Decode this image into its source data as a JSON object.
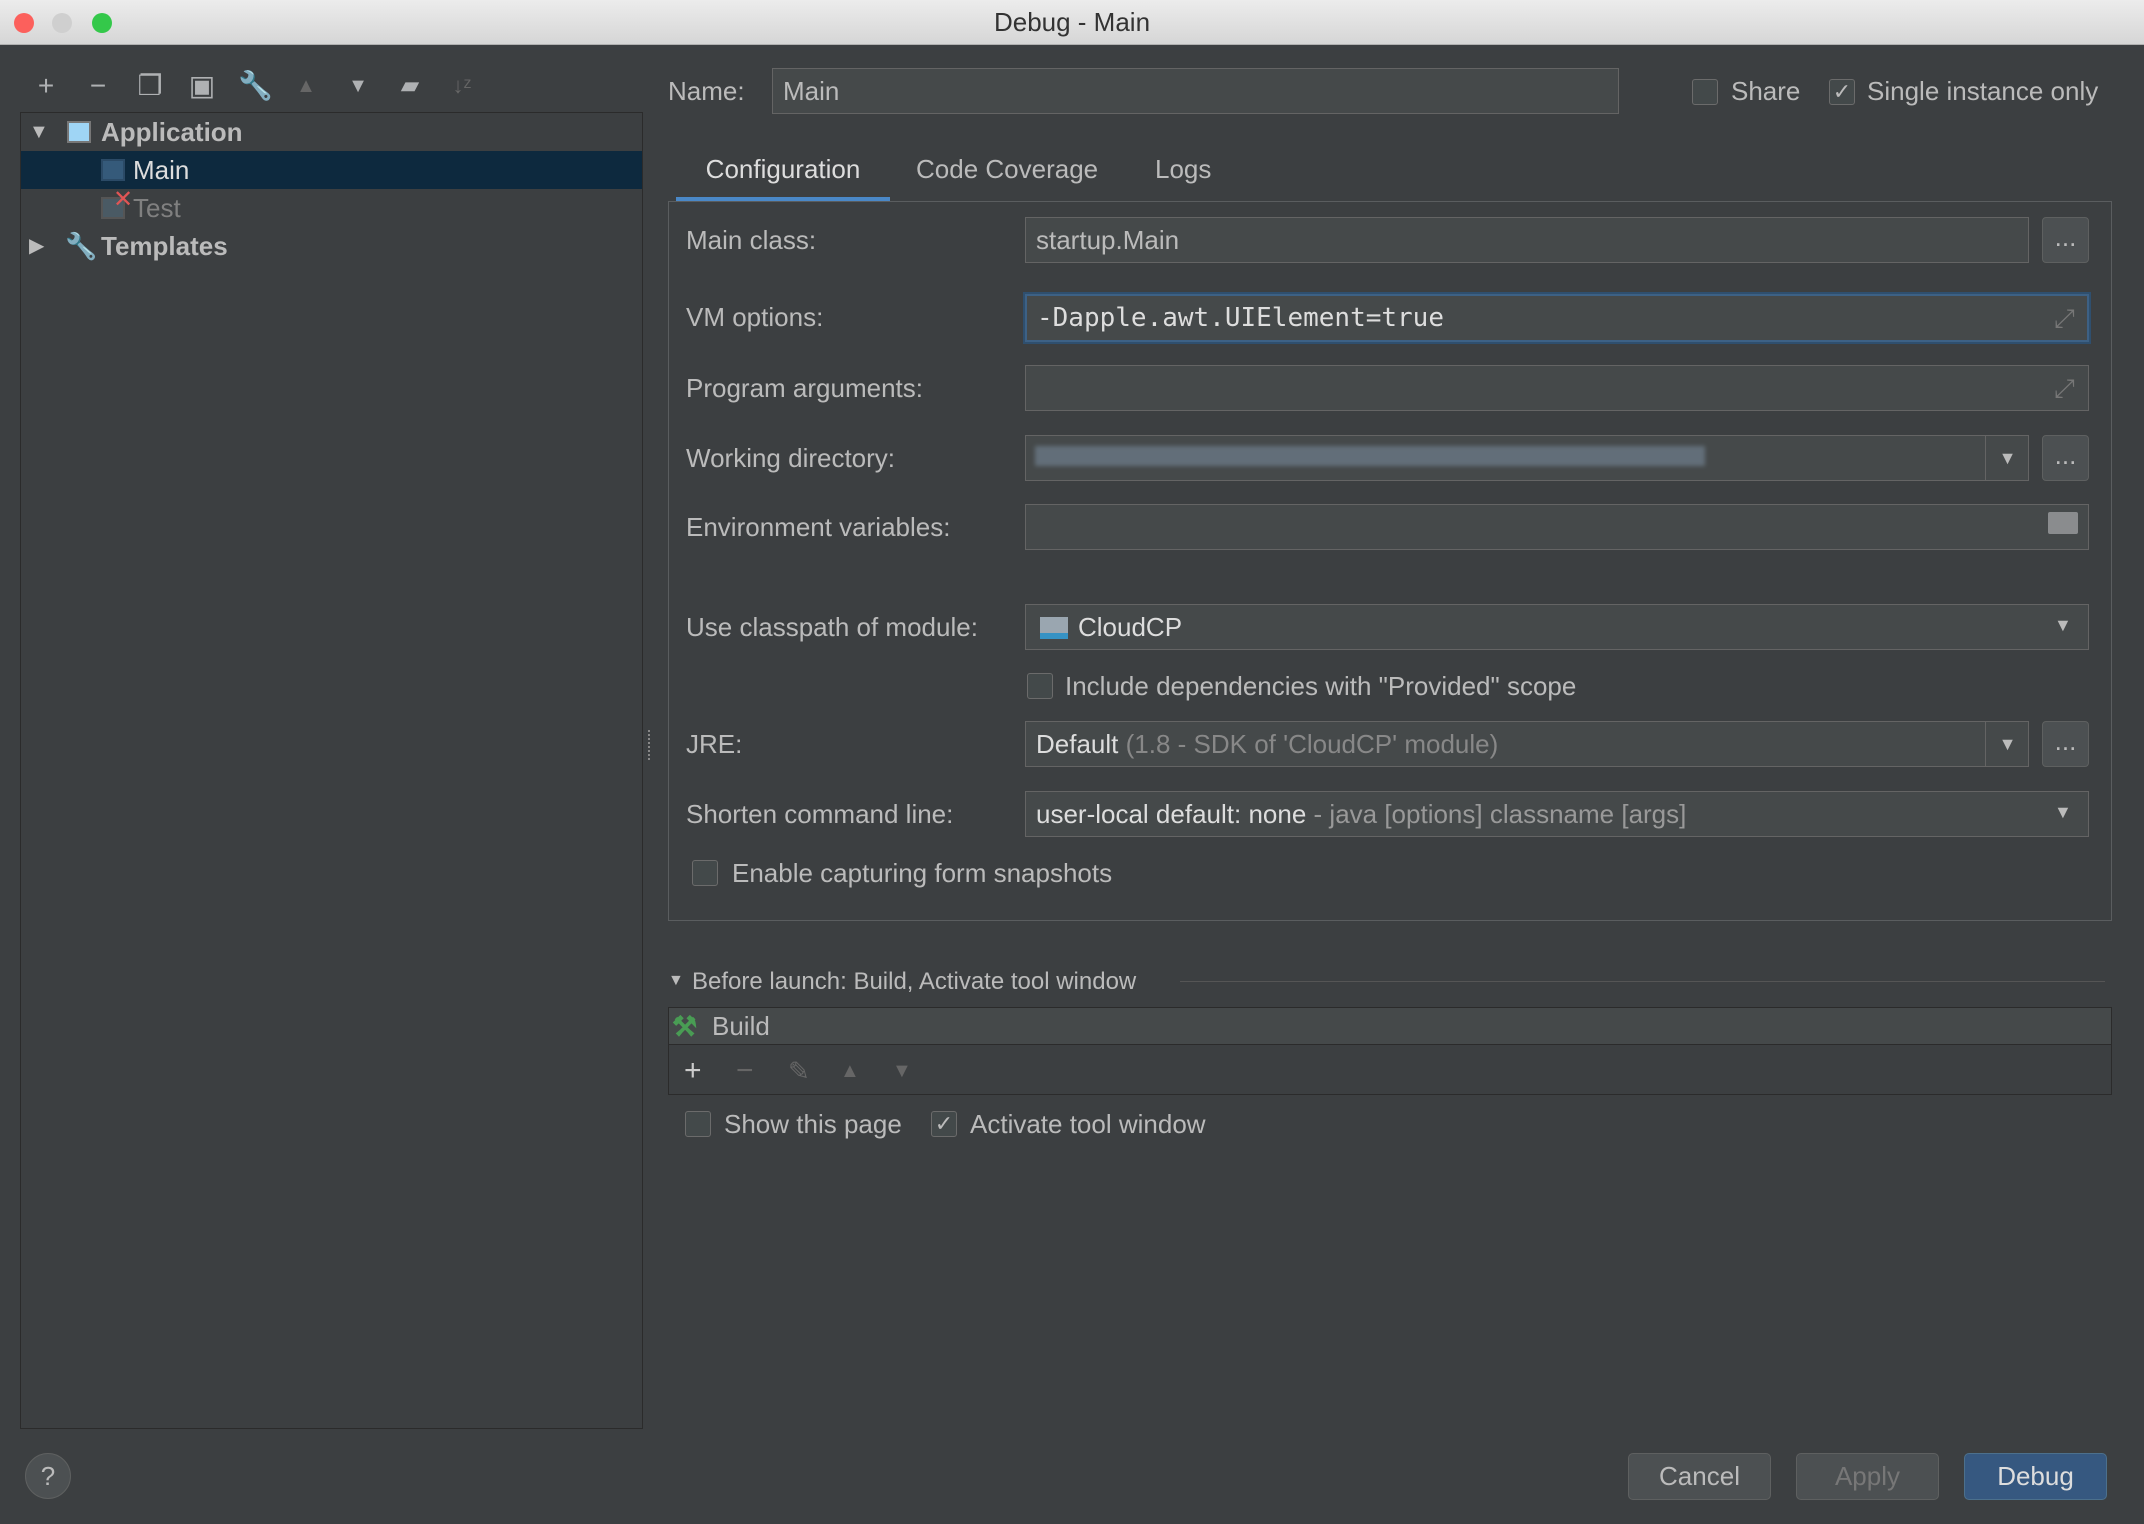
{
  "window": {
    "title": "Debug - Main"
  },
  "toolbar": {
    "icons": [
      "add-icon",
      "remove-icon",
      "copy-icon",
      "save-icon",
      "wrench-icon",
      "move-up-icon",
      "move-down-icon",
      "new-folder-icon",
      "sort-icon"
    ]
  },
  "tree": {
    "items": [
      {
        "label": "Application",
        "expanded": true
      },
      {
        "label": "Main",
        "selected": true
      },
      {
        "label": "Test",
        "error": true
      },
      {
        "label": "Templates",
        "expanded": false
      }
    ]
  },
  "header": {
    "name_label": "Name:",
    "name_value": "Main",
    "share_label": "Share",
    "share_checked": false,
    "single_label": "Single instance only",
    "single_checked": true
  },
  "tabs": [
    {
      "label": "Configuration",
      "active": true
    },
    {
      "label": "Code Coverage"
    },
    {
      "label": "Logs"
    }
  ],
  "form": {
    "main_class_label": "Main class:",
    "main_class": "startup.Main",
    "vm_label": "VM options:",
    "vm_value": "-Dapple.awt.UIElement=true",
    "args_label": "Program arguments:",
    "args_value": "",
    "wd_label": "Working directory:",
    "env_label": "Environment variables:",
    "env_value": "",
    "module_label": "Use classpath of module:",
    "module_value": "CloudCP",
    "include_label": "Include dependencies with \"Provided\" scope",
    "include_checked": false,
    "jre_label": "JRE:",
    "jre_value": "Default",
    "jre_hint": "(1.8 - SDK of 'CloudCP' module)",
    "shorten_label": "Shorten command line:",
    "shorten_value": "user-local default: none",
    "shorten_hint": "- java [options] classname [args]",
    "snapshots_label": "Enable capturing form snapshots",
    "snapshots_checked": false,
    "browse": "..."
  },
  "before_launch": {
    "title": "Before launch: Build, Activate tool window",
    "items": [
      "Build"
    ],
    "show_page_label": "Show this page",
    "show_page_checked": false,
    "activate_label": "Activate tool window",
    "activate_checked": true
  },
  "buttons": {
    "help": "?",
    "cancel": "Cancel",
    "apply": "Apply",
    "debug": "Debug"
  },
  "colors": {
    "accent": "#365880",
    "selection": "#0d293e",
    "build_icon": "#499c54",
    "error": "#e05555"
  }
}
